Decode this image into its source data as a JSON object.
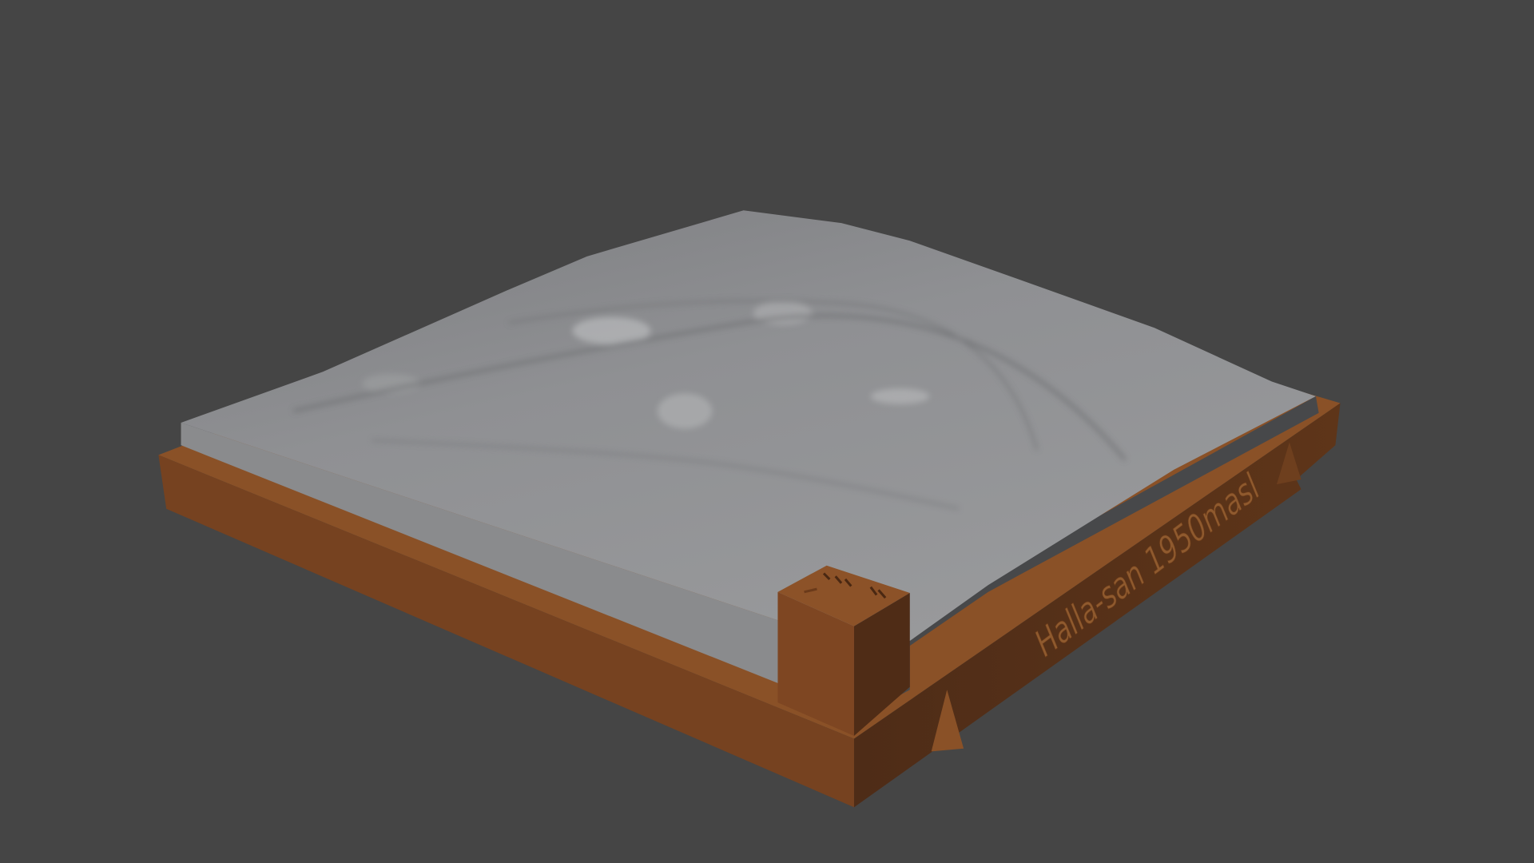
{
  "viewport": {
    "background_color": "#454545"
  },
  "model": {
    "label": "Halla-san 1950masl",
    "terrain_color": "#8e8f91",
    "base_color": "#7a4522"
  }
}
